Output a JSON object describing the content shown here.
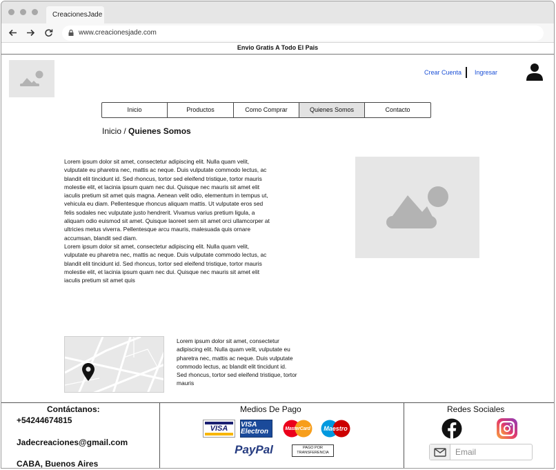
{
  "browser": {
    "tab_title": "CreacionesJade",
    "url": "www.creacionesjade.com"
  },
  "announcement": "Envio Gratis A Todo El Pais",
  "header": {
    "create_account": "Crear Cuenta",
    "login": "Ingresar"
  },
  "nav": {
    "items": [
      "Inicio",
      "Productos",
      "Como Comprar",
      "Quienes Somos",
      "Contacto"
    ],
    "active": "Quienes Somos"
  },
  "breadcrumb": {
    "home": "Inicio",
    "separator": " / ",
    "current": "Quienes Somos"
  },
  "about": {
    "paragraph_1": "Lorem ipsum dolor sit amet, consectetur adipiscing elit. Nulla quam velit, vulputate eu pharetra nec, mattis ac neque. Duis vulputate commodo lectus, ac blandit elit tincidunt id. Sed rhoncus, tortor sed eleifend tristique, tortor mauris molestie elit, et lacinia ipsum quam nec dui. Quisque nec mauris sit amet elit iaculis pretium sit amet quis magna. Aenean velit odio, elementum in tempus ut, vehicula eu diam. Pellentesque rhoncus aliquam mattis. Ut vulputate eros sed felis sodales nec vulputate justo hendrerit. Vivamus varius pretium ligula, a aliquam odio euismod sit amet. Quisque laoreet sem sit amet orci ullamcorper at ultricies metus viverra. Pellentesque arcu mauris, malesuada quis ornare accumsan, blandit sed diam.",
    "paragraph_2": "Lorem ipsum dolor sit amet, consectetur adipiscing elit. Nulla quam velit, vulputate eu pharetra nec, mattis ac neque. Duis vulputate commodo lectus, ac blandit elit tincidunt id. Sed rhoncus, tortor sed eleifend tristique, tortor mauris molestie elit, et lacinia ipsum quam nec dui. Quisque nec mauris sit amet elit iaculis pretium sit amet quis",
    "map_text": "Lorem ipsum dolor sit amet, consectetur adipiscing elit. Nulla quam velit, vulputate eu pharetra nec, mattis ac neque. Duis vulputate commodo lectus, ac blandit elit tincidunt id. Sed rhoncus, tortor sed eleifend tristique, tortor mauris"
  },
  "footer": {
    "contact_title": "Contáctanos:",
    "phone": "+54244674815",
    "email": "Jadecreaciones@gmail.com",
    "location": "CABA, Buenos Aires",
    "payment_title": "Medios De Pago",
    "payment_methods": [
      "VISA",
      "VISA Electron",
      "MasterCard",
      "Maestro",
      "PayPal",
      "PAGO POR TRANSFERENCIA"
    ],
    "social_title": "Redes Sociales",
    "email_placeholder": "Email"
  },
  "colors": {
    "link": "#1a4fd6",
    "placeholder_bg": "#e6e6e6",
    "placeholder_icon": "#b3b3b3",
    "nav_active_bg": "#e2e2e2",
    "instagram_gradient": [
      "#f9a73c",
      "#e33a6b",
      "#8a3ab9"
    ]
  },
  "icons": {
    "user": "user-icon",
    "image_placeholder": "image-placeholder-icon",
    "map_pin": "map-pin-icon",
    "facebook": "facebook-icon",
    "instagram": "instagram-icon",
    "mail": "mail-icon"
  }
}
